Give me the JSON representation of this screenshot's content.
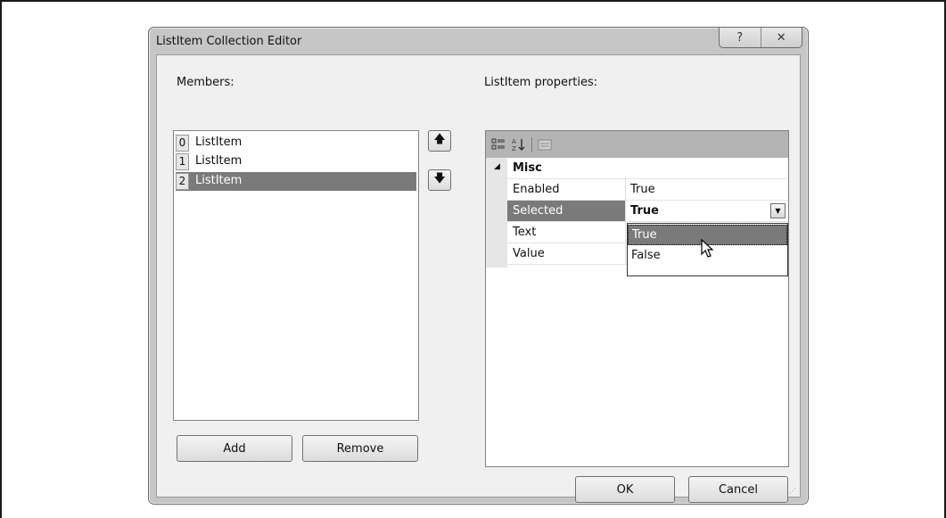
{
  "dialog": {
    "title": "ListItem Collection Editor",
    "help_glyph": "?",
    "close_glyph": "✕"
  },
  "members": {
    "label": "Members:",
    "items": [
      {
        "index": "0",
        "text": "ListItem",
        "selected": false
      },
      {
        "index": "1",
        "text": "ListItem",
        "selected": false
      },
      {
        "index": "2",
        "text": "ListItem",
        "selected": true
      }
    ],
    "add_label": "Add",
    "remove_label": "Remove",
    "move_up_glyph": "🡅",
    "move_down_glyph": "🡇"
  },
  "properties": {
    "label": "ListItem properties:",
    "category": "Misc",
    "rows": [
      {
        "name": "Enabled",
        "value": "True"
      },
      {
        "name": "Selected",
        "value": "True"
      },
      {
        "name": "Text",
        "value": ""
      },
      {
        "name": "Value",
        "value": ""
      }
    ],
    "dropdown_options": [
      "True",
      "False"
    ],
    "dropdown_highlight": "True",
    "toolbar_icons": [
      "categorized-icon",
      "alphabetical-icon",
      "property-pages-icon"
    ]
  },
  "footer": {
    "ok_label": "OK",
    "cancel_label": "Cancel"
  },
  "colors": {
    "selection": "#7a7a7a",
    "toolbar": "#b4b4b4"
  }
}
